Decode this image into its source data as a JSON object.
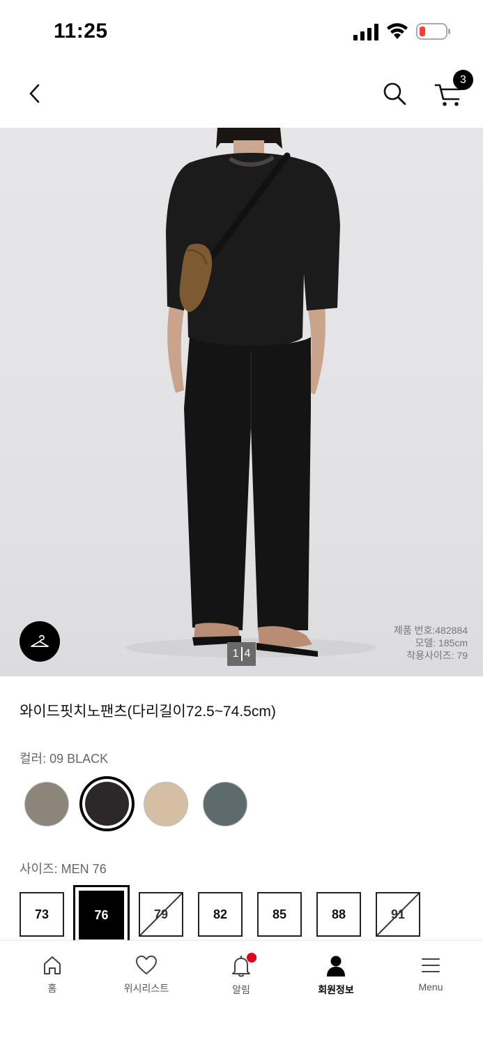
{
  "status_bar": {
    "time": "11:25"
  },
  "header": {
    "cart_count": "3"
  },
  "gallery": {
    "page_current": "1",
    "page_total": "4",
    "model_info": [
      "제품 번호:482884",
      "모델: 185cm",
      "착용사이즈: 79"
    ]
  },
  "product": {
    "title": "와이드핏치노팬츠(다리길이72.5~74.5cm)",
    "color_label": "컬러: 09 BLACK",
    "swatches": [
      {
        "name": "olive-gray",
        "hex": "#8c857a",
        "selected": false
      },
      {
        "name": "black",
        "hex": "#2c282a",
        "selected": true
      },
      {
        "name": "beige",
        "hex": "#d5bfa4",
        "selected": false
      },
      {
        "name": "teal-gray",
        "hex": "#5d6b6c",
        "selected": false
      }
    ],
    "size_label": "사이즈: MEN 76",
    "sizes": [
      {
        "label": "73",
        "available": true,
        "selected": false
      },
      {
        "label": "76",
        "available": true,
        "selected": true
      },
      {
        "label": "79",
        "available": false,
        "selected": false
      },
      {
        "label": "82",
        "available": true,
        "selected": false
      },
      {
        "label": "85",
        "available": true,
        "selected": false
      },
      {
        "label": "88",
        "available": true,
        "selected": false
      },
      {
        "label": "91",
        "available": false,
        "selected": false
      }
    ]
  },
  "tabbar": [
    {
      "label": "홈",
      "icon": "home-icon"
    },
    {
      "label": "위시리스트",
      "icon": "heart-icon"
    },
    {
      "label": "알림",
      "icon": "bell-icon"
    },
    {
      "label": "회원정보",
      "icon": "person-icon"
    },
    {
      "label": "Menu",
      "icon": "menu-icon"
    }
  ],
  "colors": {
    "notification_dot": "#e0001b",
    "badge": "#000000"
  }
}
